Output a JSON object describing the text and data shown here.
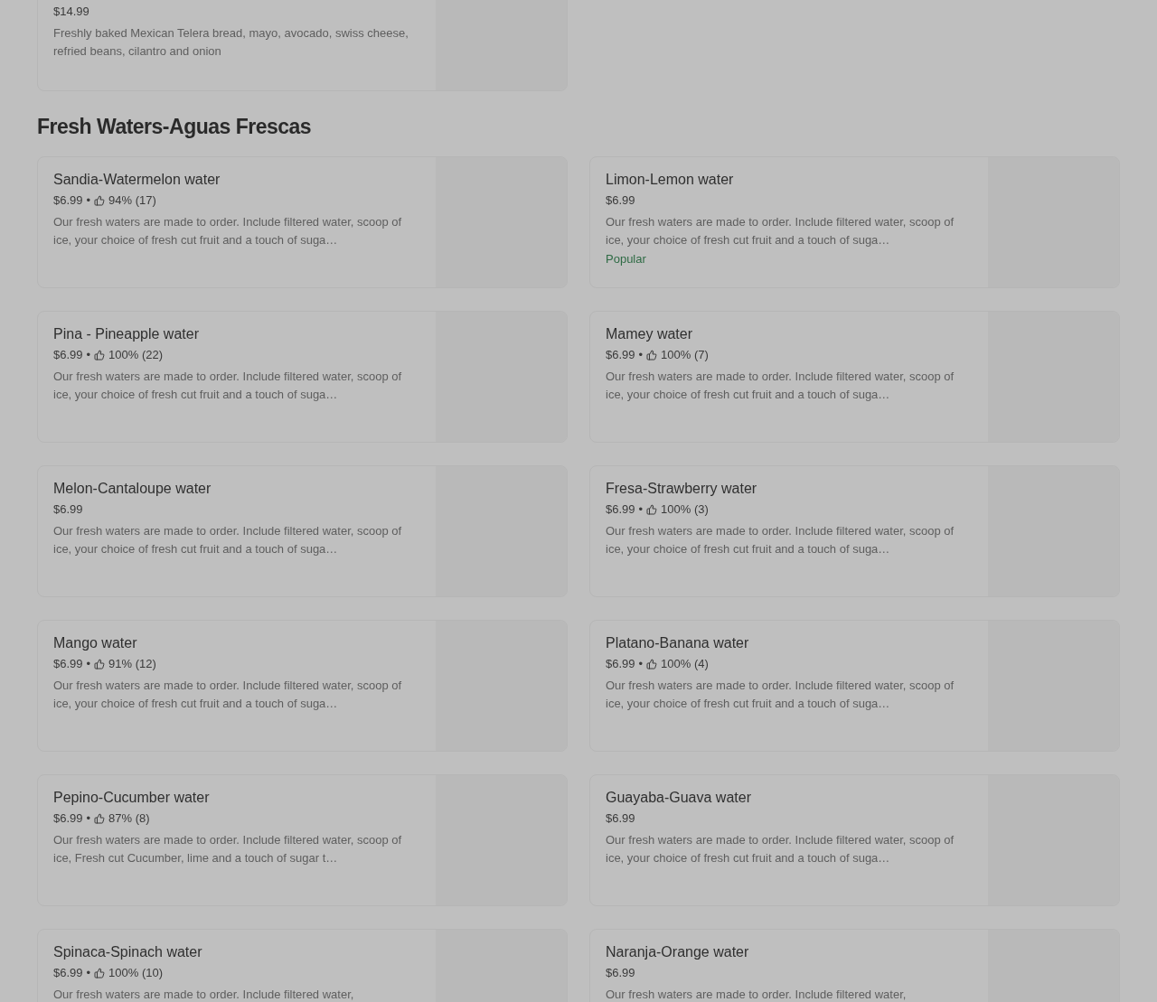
{
  "previous_item": {
    "price": "$14.99",
    "description": "Freshly baked Mexican Telera bread, mayo, avocado, swiss cheese, refried beans, cilantro and onion"
  },
  "section": {
    "title": "Fresh Waters-Aguas Frescas",
    "items": [
      {
        "name": "Sandia-Watermelon water",
        "price": "$6.99",
        "separator": "•",
        "rating": "94% (17)",
        "description": "Our fresh waters are made to order. Include filtered water, scoop of ice, your choice of fresh cut fruit and a touch of suga…"
      },
      {
        "name": "Limon-Lemon water",
        "price": "$6.99",
        "description": "Our fresh waters are made to order. Include filtered water, scoop of ice, your choice of fresh cut fruit and a touch of suga…",
        "badge": "Popular"
      },
      {
        "name": "Pina - Pineapple water",
        "price": "$6.99",
        "separator": "•",
        "rating": "100% (22)",
        "description": "Our fresh waters are made to order. Include filtered water, scoop of ice, your choice of fresh cut fruit and a touch of suga…"
      },
      {
        "name": "Mamey water",
        "price": "$6.99",
        "separator": "•",
        "rating": "100% (7)",
        "description": "Our fresh waters are made to order. Include filtered water, scoop of ice, your choice of fresh cut fruit and a touch of suga…"
      },
      {
        "name": "Melon-Cantaloupe water",
        "price": "$6.99",
        "description": "Our fresh waters are made to order. Include filtered water, scoop of ice, your choice of fresh cut fruit and a touch of suga…"
      },
      {
        "name": "Fresa-Strawberry water",
        "price": "$6.99",
        "separator": "•",
        "rating": "100% (3)",
        "description": "Our fresh waters are made to order. Include filtered water, scoop of ice, your choice of fresh cut fruit and a touch of suga…"
      },
      {
        "name": "Mango water",
        "price": "$6.99",
        "separator": "•",
        "rating": "91% (12)",
        "description": "Our fresh waters are made to order. Include filtered water, scoop of ice, your choice of fresh cut fruit and a touch of suga…"
      },
      {
        "name": "Platano-Banana water",
        "price": "$6.99",
        "separator": "•",
        "rating": "100% (4)",
        "description": "Our fresh waters are made to order. Include filtered water, scoop of ice, your choice of fresh cut fruit and a touch of suga…"
      },
      {
        "name": "Pepino-Cucumber water",
        "price": "$6.99",
        "separator": "•",
        "rating": "87% (8)",
        "description": "Our fresh waters are made to order. Include filtered water, scoop of ice, Fresh cut Cucumber, lime and a touch of sugar t…"
      },
      {
        "name": "Guayaba-Guava water",
        "price": "$6.99",
        "description": "Our fresh waters are made to order. Include filtered water, scoop of ice, your choice of fresh cut fruit and a touch of suga…"
      },
      {
        "name": "Spinaca-Spinach water",
        "price": "$6.99",
        "separator": "•",
        "rating": "100% (10)",
        "description": "Our fresh waters are made to order. Include filtered water,"
      },
      {
        "name": "Naranja-Orange water",
        "price": "$6.99",
        "description": "Our fresh waters are made to order. Include filtered water,"
      }
    ]
  }
}
